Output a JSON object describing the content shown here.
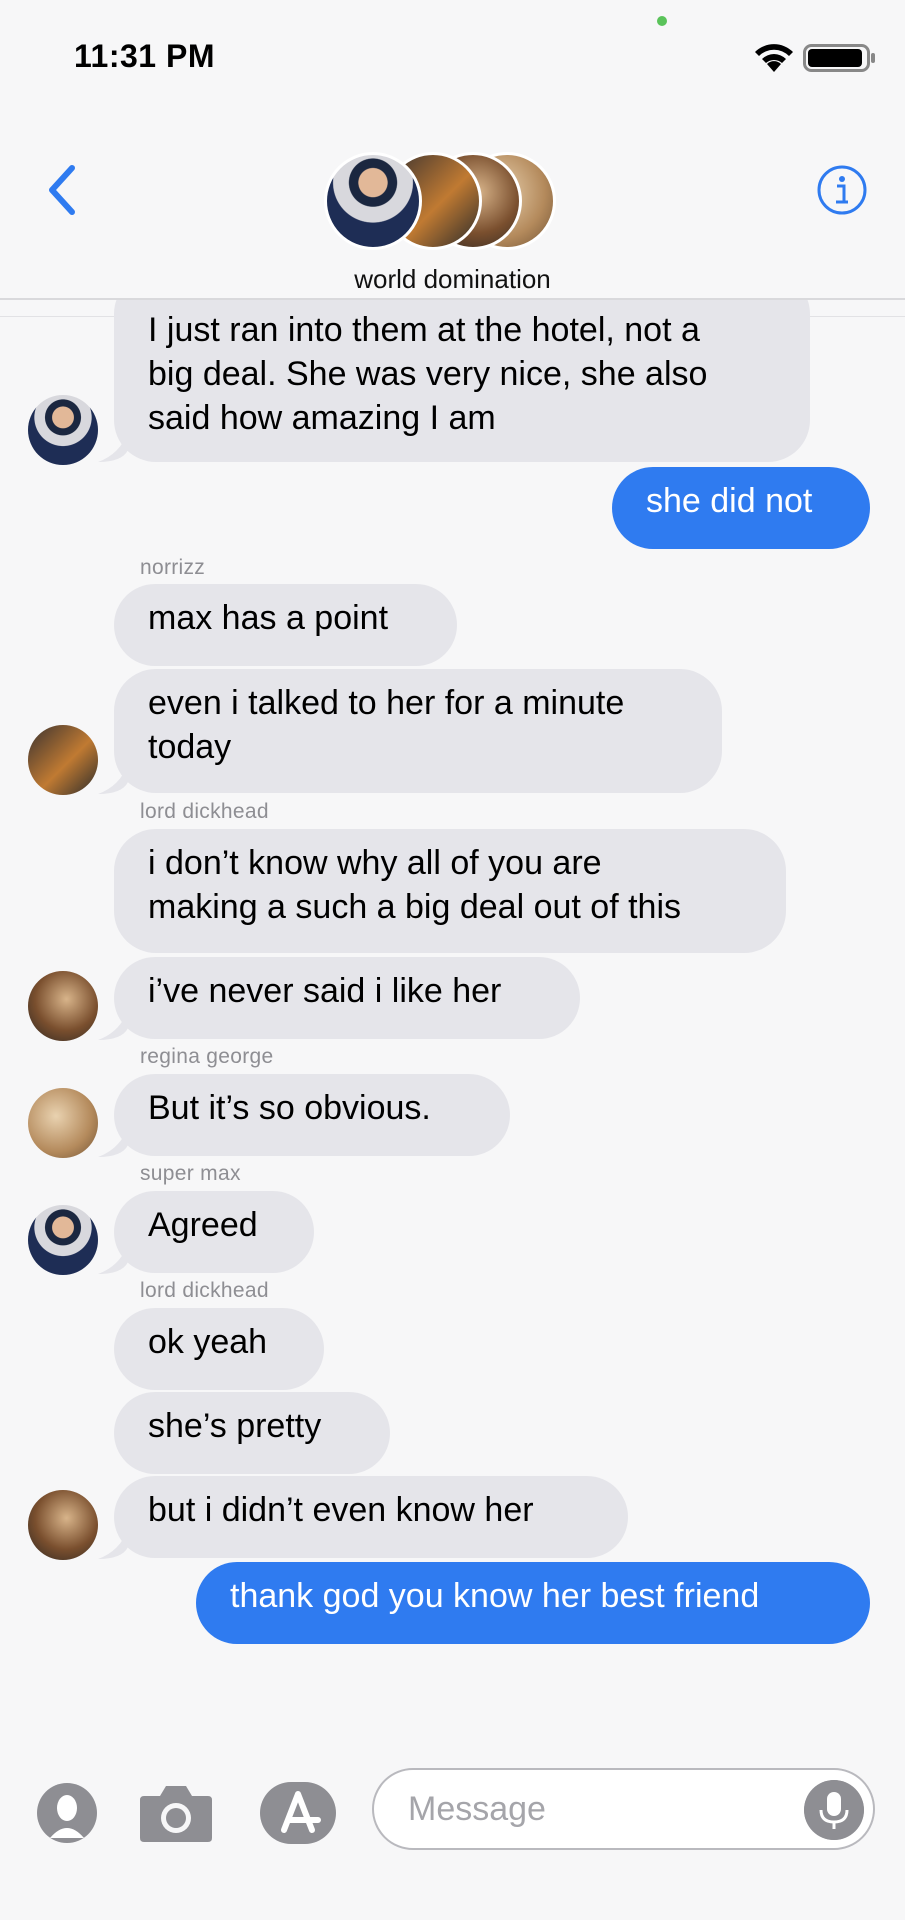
{
  "status_bar": {
    "time": "11:31 PM"
  },
  "header": {
    "group_name": "world domination",
    "back_icon": "chevron-left-icon",
    "info_icon": "info-icon"
  },
  "messages": [
    {
      "type": "in",
      "lines": [
        "I just ran into them at the hotel, not a",
        "big deal. She was very nice, she also",
        "said how amazing I am"
      ]
    },
    {
      "type": "out",
      "text": "she did not"
    },
    {
      "sender": "norrizz"
    },
    {
      "type": "in",
      "text": "max has a point"
    },
    {
      "type": "in",
      "lines": [
        "even i talked to her for a minute",
        "today"
      ]
    },
    {
      "sender": "lord dickhead"
    },
    {
      "type": "in",
      "lines": [
        "i don’t know why all of you are",
        "making a such a big deal out of this"
      ]
    },
    {
      "type": "in",
      "text": "i’ve never said i like her"
    },
    {
      "sender": "regina george"
    },
    {
      "type": "in",
      "text": "But it’s so obvious."
    },
    {
      "sender": "super max"
    },
    {
      "type": "in",
      "text": "Agreed"
    },
    {
      "sender": "lord dickhead"
    },
    {
      "type": "in",
      "text": "ok yeah"
    },
    {
      "type": "in",
      "text": "she’s pretty"
    },
    {
      "type": "in",
      "text": "but i didn’t even know her"
    },
    {
      "type": "out",
      "text": "thank god you know her best friend"
    }
  ],
  "input": {
    "placeholder": "Message",
    "icons": [
      "memoji-icon",
      "camera-icon",
      "app-store-icon",
      "microphone-icon"
    ]
  },
  "colors": {
    "outgoing": "#2f7bf0",
    "incoming": "#e5e5ea",
    "accent": "#2f7bf0"
  }
}
